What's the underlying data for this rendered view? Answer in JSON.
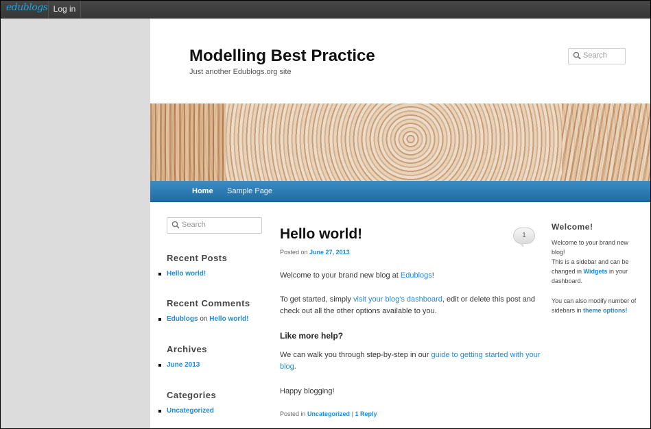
{
  "adminbar": {
    "logo": "edublogs",
    "login": "Log in"
  },
  "site": {
    "title": "Modelling Best Practice",
    "description": "Just another Edublogs.org site"
  },
  "header_search": {
    "placeholder": "Search"
  },
  "nav": {
    "items": [
      "Home",
      "Sample Page"
    ]
  },
  "sidebar": {
    "search_placeholder": "Search",
    "recent_posts": {
      "title": "Recent Posts",
      "items": [
        "Hello world!"
      ]
    },
    "recent_comments": {
      "title": "Recent Comments",
      "author": "Edublogs",
      "on": "on",
      "post": "Hello world!"
    },
    "archives": {
      "title": "Archives",
      "items": [
        "June 2013"
      ]
    },
    "categories": {
      "title": "Categories",
      "items": [
        "Uncategorized"
      ]
    }
  },
  "post": {
    "title": "Hello world!",
    "comment_count": "1",
    "posted_on_label": "Posted on",
    "date": "June 27, 2013",
    "p1_pre": "Welcome to your brand new blog at ",
    "p1_link": "Edublogs",
    "p1_post": "!",
    "p2_pre": "To get started, simply ",
    "p2_link": "visit your blog's dashboard",
    "p2_post": ", edit or delete this post and check out all the other options available to you.",
    "subhead": "Like more help?",
    "p3_pre": "We can walk you through step-by-step in our ",
    "p3_link": "guide to getting started with your blog",
    "p3_post": ".",
    "p4": "Happy blogging!",
    "posted_in_label": "Posted in",
    "category": "Uncategorized",
    "separator": "|",
    "reply": "1 Reply"
  },
  "right_sidebar": {
    "title": "Welcome!",
    "p1": "Welcome to your brand new blog!",
    "p2_pre": "This is a sidebar and can be changed in ",
    "p2_link": "Widgets",
    "p2_post": " in your dashboard.",
    "p3_pre": "You can also modify number of sidebars in ",
    "p3_link": "theme options!"
  },
  "icons": {
    "search": "search-icon",
    "comment": "comment-bubble-icon"
  },
  "colors": {
    "link": "#1b8be0",
    "nav": "#2a79b3",
    "adminbar": "#3d3d3d"
  }
}
